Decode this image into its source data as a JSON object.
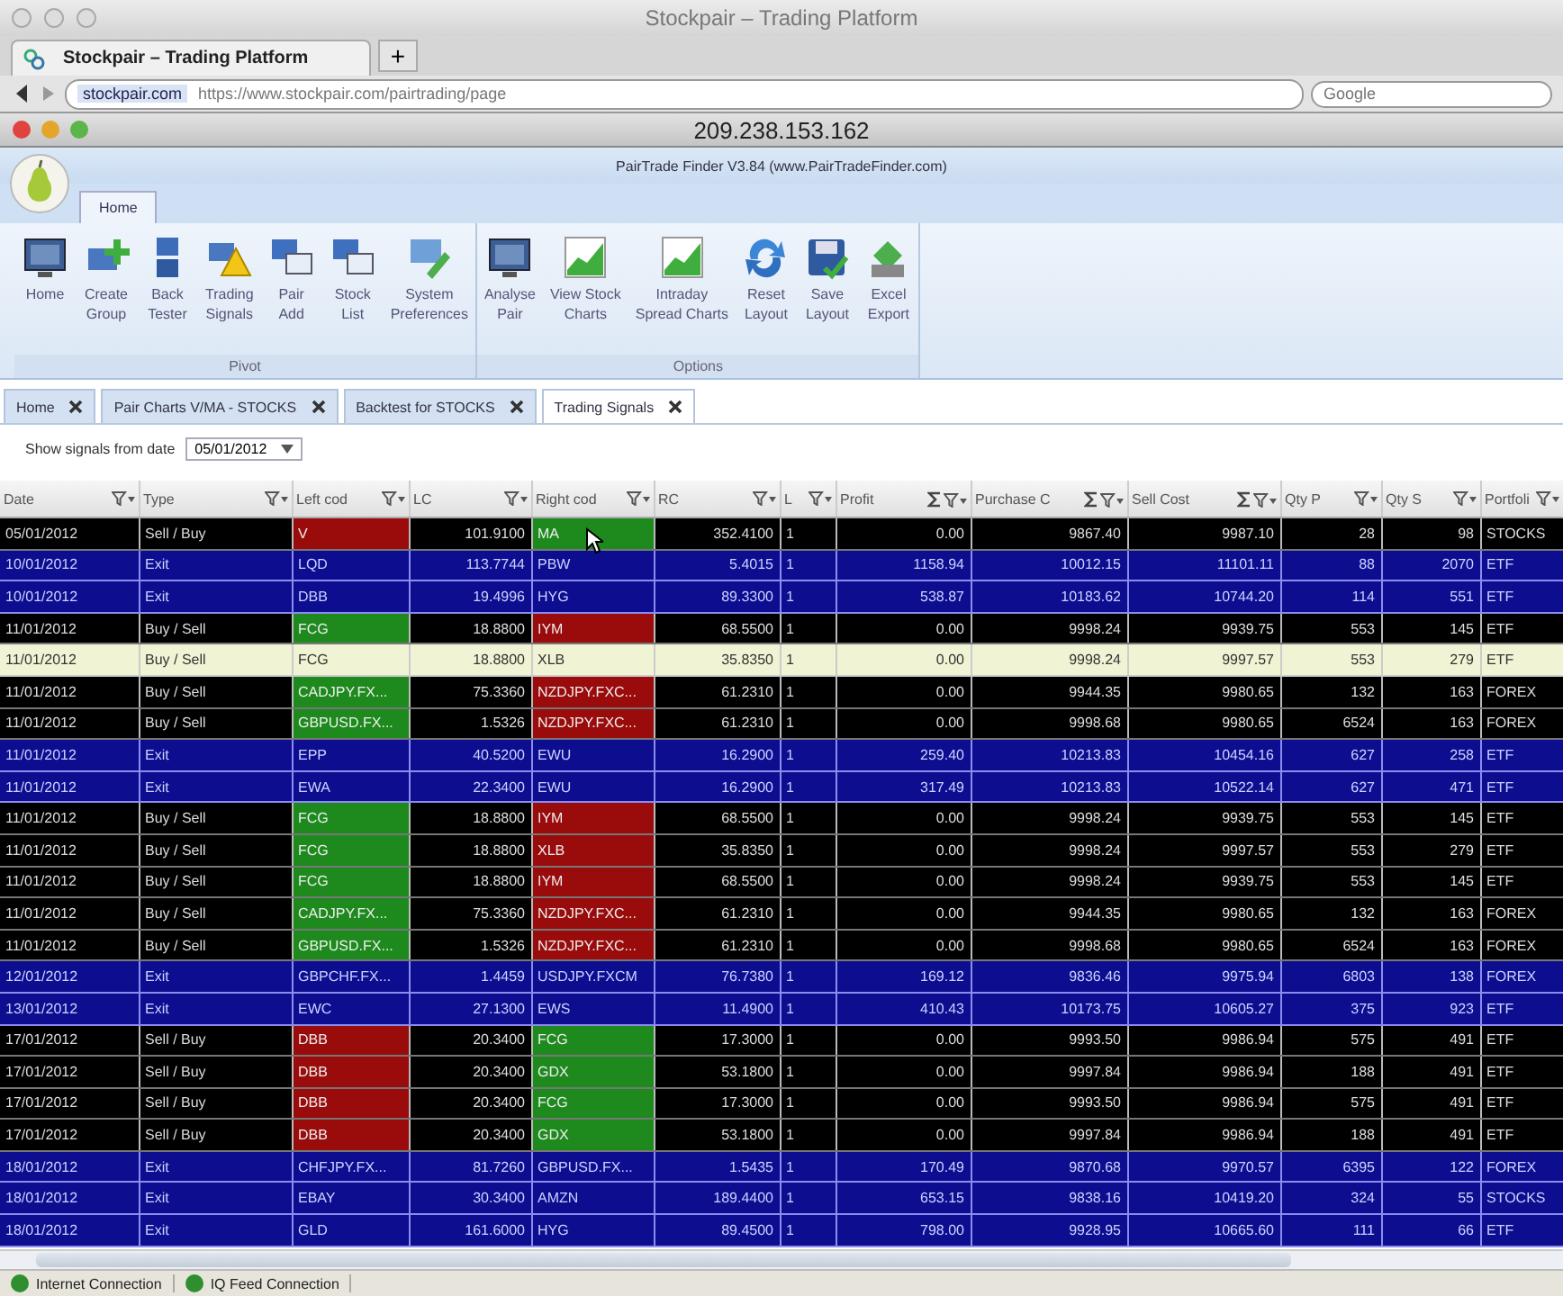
{
  "browser": {
    "title": "Stockpair – Trading Platform",
    "tab": "Stockpair – Trading Platform",
    "new_tab": "+",
    "site": "stockpair.com",
    "url": "https://www.stockpair.com/pairtrading/page",
    "search_placeholder": "Google"
  },
  "remote": {
    "title": "209.238.153.162"
  },
  "app": {
    "title": "PairTrade Finder V3.84 (www.PairTradeFinder.com)"
  },
  "ribbon_tabs": [
    {
      "label": "Home",
      "selected": true
    }
  ],
  "ribbon_groups": [
    {
      "label": "Pivot",
      "buttons": [
        "Home",
        "Create\nGroup",
        "Back\nTester",
        "Trading\nSignals",
        "Pair\nAdd",
        "Stock\nList",
        "System\nPreferences"
      ]
    },
    {
      "label": "Options",
      "buttons": [
        "Analyse\nPair",
        "View Stock\nCharts",
        "Intraday\nSpread Charts",
        "Reset\nLayout",
        "Save\nLayout",
        "Excel\nExport"
      ]
    }
  ],
  "doc_tabs": [
    {
      "label": "Home",
      "selected": false
    },
    {
      "label": "Pair Charts V/MA - STOCKS",
      "selected": false
    },
    {
      "label": "Backtest for STOCKS",
      "selected": false
    },
    {
      "label": "Trading Signals",
      "selected": true
    }
  ],
  "filter": {
    "label": "Show signals from date",
    "value": "05/01/2012"
  },
  "table": {
    "columns": [
      {
        "label": "Date",
        "summed": false
      },
      {
        "label": "Type",
        "summed": false
      },
      {
        "label": "Left cod",
        "summed": false
      },
      {
        "label": "LC",
        "summed": false
      },
      {
        "label": "Right cod",
        "summed": false
      },
      {
        "label": "RC",
        "summed": false
      },
      {
        "label": "L",
        "summed": false
      },
      {
        "label": "Profit",
        "summed": true
      },
      {
        "label": "Purchase C",
        "summed": true
      },
      {
        "label": "Sell Cost",
        "summed": true
      },
      {
        "label": "Qty P",
        "summed": false
      },
      {
        "label": "Qty S",
        "summed": false
      },
      {
        "label": "Portfoli",
        "summed": false
      }
    ],
    "rows": [
      {
        "kind": "signal",
        "selected": false,
        "date": "05/01/2012",
        "type": "Sell / Buy",
        "left": {
          "code": "V",
          "color": "#9a0b0b"
        },
        "lc": "101.9100",
        "right": {
          "code": "MA",
          "color": "#1e8a1e"
        },
        "rc": "352.4100",
        "l": "1",
        "profit": "0.00",
        "purchase_cost": "9867.40",
        "sell_cost": "9987.10",
        "qty_p": "28",
        "qty_s": "98",
        "portfolio": "STOCKS"
      },
      {
        "kind": "exit",
        "selected": false,
        "date": "10/01/2012",
        "type": "Exit",
        "left": {
          "code": "LQD"
        },
        "lc": "113.7744",
        "right": {
          "code": "PBW"
        },
        "rc": "5.4015",
        "l": "1",
        "profit": "1158.94",
        "purchase_cost": "10012.15",
        "sell_cost": "11101.11",
        "qty_p": "88",
        "qty_s": "2070",
        "portfolio": "ETF"
      },
      {
        "kind": "exit",
        "selected": false,
        "date": "10/01/2012",
        "type": "Exit",
        "left": {
          "code": "DBB"
        },
        "lc": "19.4996",
        "right": {
          "code": "HYG"
        },
        "rc": "89.3300",
        "l": "1",
        "profit": "538.87",
        "purchase_cost": "10183.62",
        "sell_cost": "10744.20",
        "qty_p": "114",
        "qty_s": "551",
        "portfolio": "ETF"
      },
      {
        "kind": "signal",
        "selected": false,
        "date": "11/01/2012",
        "type": "Buy / Sell",
        "left": {
          "code": "FCG",
          "color": "#1e8a1e"
        },
        "lc": "18.8800",
        "right": {
          "code": "IYM",
          "color": "#9a0b0b"
        },
        "rc": "68.5500",
        "l": "1",
        "profit": "0.00",
        "purchase_cost": "9998.24",
        "sell_cost": "9939.75",
        "qty_p": "553",
        "qty_s": "145",
        "portfolio": "ETF"
      },
      {
        "kind": "signal",
        "selected": true,
        "date": "11/01/2012",
        "type": "Buy / Sell",
        "left": {
          "code": "FCG"
        },
        "lc": "18.8800",
        "right": {
          "code": "XLB"
        },
        "rc": "35.8350",
        "l": "1",
        "profit": "0.00",
        "purchase_cost": "9998.24",
        "sell_cost": "9997.57",
        "qty_p": "553",
        "qty_s": "279",
        "portfolio": "ETF"
      },
      {
        "kind": "signal",
        "selected": false,
        "date": "11/01/2012",
        "type": "Buy / Sell",
        "left": {
          "code": "CADJPY.FX...",
          "color": "#1e8a1e"
        },
        "lc": "75.3360",
        "right": {
          "code": "NZDJPY.FXC...",
          "color": "#9a0b0b"
        },
        "rc": "61.2310",
        "l": "1",
        "profit": "0.00",
        "purchase_cost": "9944.35",
        "sell_cost": "9980.65",
        "qty_p": "132",
        "qty_s": "163",
        "portfolio": "FOREX"
      },
      {
        "kind": "signal",
        "selected": false,
        "date": "11/01/2012",
        "type": "Buy / Sell",
        "left": {
          "code": "GBPUSD.FX...",
          "color": "#1e8a1e"
        },
        "lc": "1.5326",
        "right": {
          "code": "NZDJPY.FXC...",
          "color": "#9a0b0b"
        },
        "rc": "61.2310",
        "l": "1",
        "profit": "0.00",
        "purchase_cost": "9998.68",
        "sell_cost": "9980.65",
        "qty_p": "6524",
        "qty_s": "163",
        "portfolio": "FOREX"
      },
      {
        "kind": "exit",
        "selected": false,
        "date": "11/01/2012",
        "type": "Exit",
        "left": {
          "code": "EPP"
        },
        "lc": "40.5200",
        "right": {
          "code": "EWU"
        },
        "rc": "16.2900",
        "l": "1",
        "profit": "259.40",
        "purchase_cost": "10213.83",
        "sell_cost": "10454.16",
        "qty_p": "627",
        "qty_s": "258",
        "portfolio": "ETF"
      },
      {
        "kind": "exit",
        "selected": false,
        "date": "11/01/2012",
        "type": "Exit",
        "left": {
          "code": "EWA"
        },
        "lc": "22.3400",
        "right": {
          "code": "EWU"
        },
        "rc": "16.2900",
        "l": "1",
        "profit": "317.49",
        "purchase_cost": "10213.83",
        "sell_cost": "10522.14",
        "qty_p": "627",
        "qty_s": "471",
        "portfolio": "ETF"
      },
      {
        "kind": "signal",
        "selected": false,
        "date": "11/01/2012",
        "type": "Buy / Sell",
        "left": {
          "code": "FCG",
          "color": "#1e8a1e"
        },
        "lc": "18.8800",
        "right": {
          "code": "IYM",
          "color": "#9a0b0b"
        },
        "rc": "68.5500",
        "l": "1",
        "profit": "0.00",
        "purchase_cost": "9998.24",
        "sell_cost": "9939.75",
        "qty_p": "553",
        "qty_s": "145",
        "portfolio": "ETF"
      },
      {
        "kind": "signal",
        "selected": false,
        "date": "11/01/2012",
        "type": "Buy / Sell",
        "left": {
          "code": "FCG",
          "color": "#1e8a1e"
        },
        "lc": "18.8800",
        "right": {
          "code": "XLB",
          "color": "#9a0b0b"
        },
        "rc": "35.8350",
        "l": "1",
        "profit": "0.00",
        "purchase_cost": "9998.24",
        "sell_cost": "9997.57",
        "qty_p": "553",
        "qty_s": "279",
        "portfolio": "ETF"
      },
      {
        "kind": "signal",
        "selected": false,
        "date": "11/01/2012",
        "type": "Buy / Sell",
        "left": {
          "code": "FCG",
          "color": "#1e8a1e"
        },
        "lc": "18.8800",
        "right": {
          "code": "IYM",
          "color": "#9a0b0b"
        },
        "rc": "68.5500",
        "l": "1",
        "profit": "0.00",
        "purchase_cost": "9998.24",
        "sell_cost": "9939.75",
        "qty_p": "553",
        "qty_s": "145",
        "portfolio": "ETF"
      },
      {
        "kind": "signal",
        "selected": false,
        "date": "11/01/2012",
        "type": "Buy / Sell",
        "left": {
          "code": "CADJPY.FX...",
          "color": "#1e8a1e"
        },
        "lc": "75.3360",
        "right": {
          "code": "NZDJPY.FXC...",
          "color": "#9a0b0b"
        },
        "rc": "61.2310",
        "l": "1",
        "profit": "0.00",
        "purchase_cost": "9944.35",
        "sell_cost": "9980.65",
        "qty_p": "132",
        "qty_s": "163",
        "portfolio": "FOREX"
      },
      {
        "kind": "signal",
        "selected": false,
        "date": "11/01/2012",
        "type": "Buy / Sell",
        "left": {
          "code": "GBPUSD.FX...",
          "color": "#1e8a1e"
        },
        "lc": "1.5326",
        "right": {
          "code": "NZDJPY.FXC...",
          "color": "#9a0b0b"
        },
        "rc": "61.2310",
        "l": "1",
        "profit": "0.00",
        "purchase_cost": "9998.68",
        "sell_cost": "9980.65",
        "qty_p": "6524",
        "qty_s": "163",
        "portfolio": "FOREX"
      },
      {
        "kind": "exit",
        "selected": false,
        "date": "12/01/2012",
        "type": "Exit",
        "left": {
          "code": "GBPCHF.FX..."
        },
        "lc": "1.4459",
        "right": {
          "code": "USDJPY.FXCM"
        },
        "rc": "76.7380",
        "l": "1",
        "profit": "169.12",
        "purchase_cost": "9836.46",
        "sell_cost": "9975.94",
        "qty_p": "6803",
        "qty_s": "138",
        "portfolio": "FOREX"
      },
      {
        "kind": "exit",
        "selected": false,
        "date": "13/01/2012",
        "type": "Exit",
        "left": {
          "code": "EWC"
        },
        "lc": "27.1300",
        "right": {
          "code": "EWS"
        },
        "rc": "11.4900",
        "l": "1",
        "profit": "410.43",
        "purchase_cost": "10173.75",
        "sell_cost": "10605.27",
        "qty_p": "375",
        "qty_s": "923",
        "portfolio": "ETF"
      },
      {
        "kind": "signal",
        "selected": false,
        "date": "17/01/2012",
        "type": "Sell / Buy",
        "left": {
          "code": "DBB",
          "color": "#9a0b0b"
        },
        "lc": "20.3400",
        "right": {
          "code": "FCG",
          "color": "#1e8a1e"
        },
        "rc": "17.3000",
        "l": "1",
        "profit": "0.00",
        "purchase_cost": "9993.50",
        "sell_cost": "9986.94",
        "qty_p": "575",
        "qty_s": "491",
        "portfolio": "ETF"
      },
      {
        "kind": "signal",
        "selected": false,
        "date": "17/01/2012",
        "type": "Sell / Buy",
        "left": {
          "code": "DBB",
          "color": "#9a0b0b"
        },
        "lc": "20.3400",
        "right": {
          "code": "GDX",
          "color": "#1e8a1e"
        },
        "rc": "53.1800",
        "l": "1",
        "profit": "0.00",
        "purchase_cost": "9997.84",
        "sell_cost": "9986.94",
        "qty_p": "188",
        "qty_s": "491",
        "portfolio": "ETF"
      },
      {
        "kind": "signal",
        "selected": false,
        "date": "17/01/2012",
        "type": "Sell / Buy",
        "left": {
          "code": "DBB",
          "color": "#9a0b0b"
        },
        "lc": "20.3400",
        "right": {
          "code": "FCG",
          "color": "#1e8a1e"
        },
        "rc": "17.3000",
        "l": "1",
        "profit": "0.00",
        "purchase_cost": "9993.50",
        "sell_cost": "9986.94",
        "qty_p": "575",
        "qty_s": "491",
        "portfolio": "ETF"
      },
      {
        "kind": "signal",
        "selected": false,
        "date": "17/01/2012",
        "type": "Sell / Buy",
        "left": {
          "code": "DBB",
          "color": "#9a0b0b"
        },
        "lc": "20.3400",
        "right": {
          "code": "GDX",
          "color": "#1e8a1e"
        },
        "rc": "53.1800",
        "l": "1",
        "profit": "0.00",
        "purchase_cost": "9997.84",
        "sell_cost": "9986.94",
        "qty_p": "188",
        "qty_s": "491",
        "portfolio": "ETF"
      },
      {
        "kind": "exit",
        "selected": false,
        "date": "18/01/2012",
        "type": "Exit",
        "left": {
          "code": "CHFJPY.FX..."
        },
        "lc": "81.7260",
        "right": {
          "code": "GBPUSD.FX..."
        },
        "rc": "1.5435",
        "l": "1",
        "profit": "170.49",
        "purchase_cost": "9870.68",
        "sell_cost": "9970.57",
        "qty_p": "6395",
        "qty_s": "122",
        "portfolio": "FOREX"
      },
      {
        "kind": "exit",
        "selected": false,
        "date": "18/01/2012",
        "type": "Exit",
        "left": {
          "code": "EBAY"
        },
        "lc": "30.3400",
        "right": {
          "code": "AMZN"
        },
        "rc": "189.4400",
        "l": "1",
        "profit": "653.15",
        "purchase_cost": "9838.16",
        "sell_cost": "10419.20",
        "qty_p": "324",
        "qty_s": "55",
        "portfolio": "STOCKS"
      },
      {
        "kind": "exit",
        "selected": false,
        "date": "18/01/2012",
        "type": "Exit",
        "left": {
          "code": "GLD"
        },
        "lc": "161.6000",
        "right": {
          "code": "HYG"
        },
        "rc": "89.4500",
        "l": "1",
        "profit": "798.00",
        "purchase_cost": "9928.95",
        "sell_cost": "10665.60",
        "qty_p": "111",
        "qty_s": "66",
        "portfolio": "ETF"
      }
    ]
  },
  "status_bar": [
    {
      "label": "Internet Connection",
      "color": "#2f8f2f"
    },
    {
      "label": "IQ Feed Connection",
      "color": "#2f8f2f"
    }
  ]
}
